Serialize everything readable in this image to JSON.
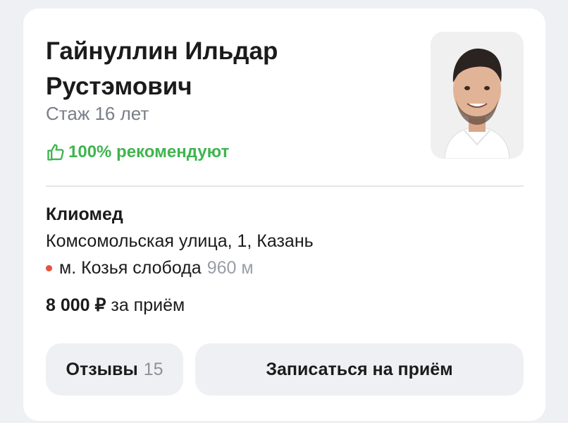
{
  "doctor": {
    "name": "Гайнуллин Ильдар Рустэмович",
    "experience": "Стаж 16 лет",
    "recommend": "100% рекомендуют",
    "recommend_icon": "thumbs-up-icon",
    "photo_icon": "doctor-photo"
  },
  "clinic": {
    "name": "Клиомед",
    "address": "Комсомольская улица, 1, Казань",
    "metro": "м. Козья слобода",
    "distance": "960 м",
    "metro_color": "#e5533f"
  },
  "price": {
    "value": "8 000 ₽",
    "suffix": " за приём"
  },
  "actions": {
    "reviews_label": "Отзывы",
    "reviews_count": "15",
    "book_label": "Записаться на приём"
  },
  "colors": {
    "accent_green": "#3fb44f",
    "button_bg": "#eef0f3"
  }
}
